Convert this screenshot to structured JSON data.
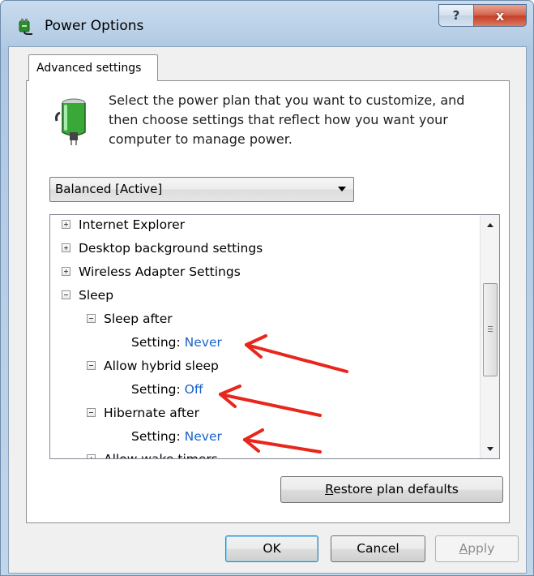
{
  "window": {
    "title": "Power Options",
    "help_label": "?",
    "close_label": "x"
  },
  "tab": {
    "label": "Advanced settings"
  },
  "description": "Select the power plan that you want to customize, and then choose settings that reflect how you want your computer to manage power.",
  "plan_select": {
    "selected": "Balanced [Active]"
  },
  "tree": {
    "items": [
      {
        "label": "Internet Explorer",
        "state": "collapsed"
      },
      {
        "label": "Desktop background settings",
        "state": "collapsed"
      },
      {
        "label": "Wireless Adapter Settings",
        "state": "collapsed"
      },
      {
        "label": "Sleep",
        "state": "expanded"
      },
      {
        "label": "Sleep after",
        "state": "expanded"
      },
      {
        "label": "Setting:",
        "value": "Never"
      },
      {
        "label": "Allow hybrid sleep",
        "state": "expanded"
      },
      {
        "label": "Setting:",
        "value": "Off"
      },
      {
        "label": "Hibernate after",
        "state": "expanded"
      },
      {
        "label": "Setting:",
        "value": "Never"
      },
      {
        "label": "Allow wake timers",
        "state": "collapsed"
      }
    ]
  },
  "buttons": {
    "restore_pre": "",
    "restore_u": "R",
    "restore_post": "estore plan defaults",
    "ok": "OK",
    "cancel": "Cancel",
    "apply_u": "A",
    "apply_post": "pply"
  },
  "colors": {
    "setting_value": "#1a62c9",
    "annotation_arrow": "#e8261c"
  }
}
